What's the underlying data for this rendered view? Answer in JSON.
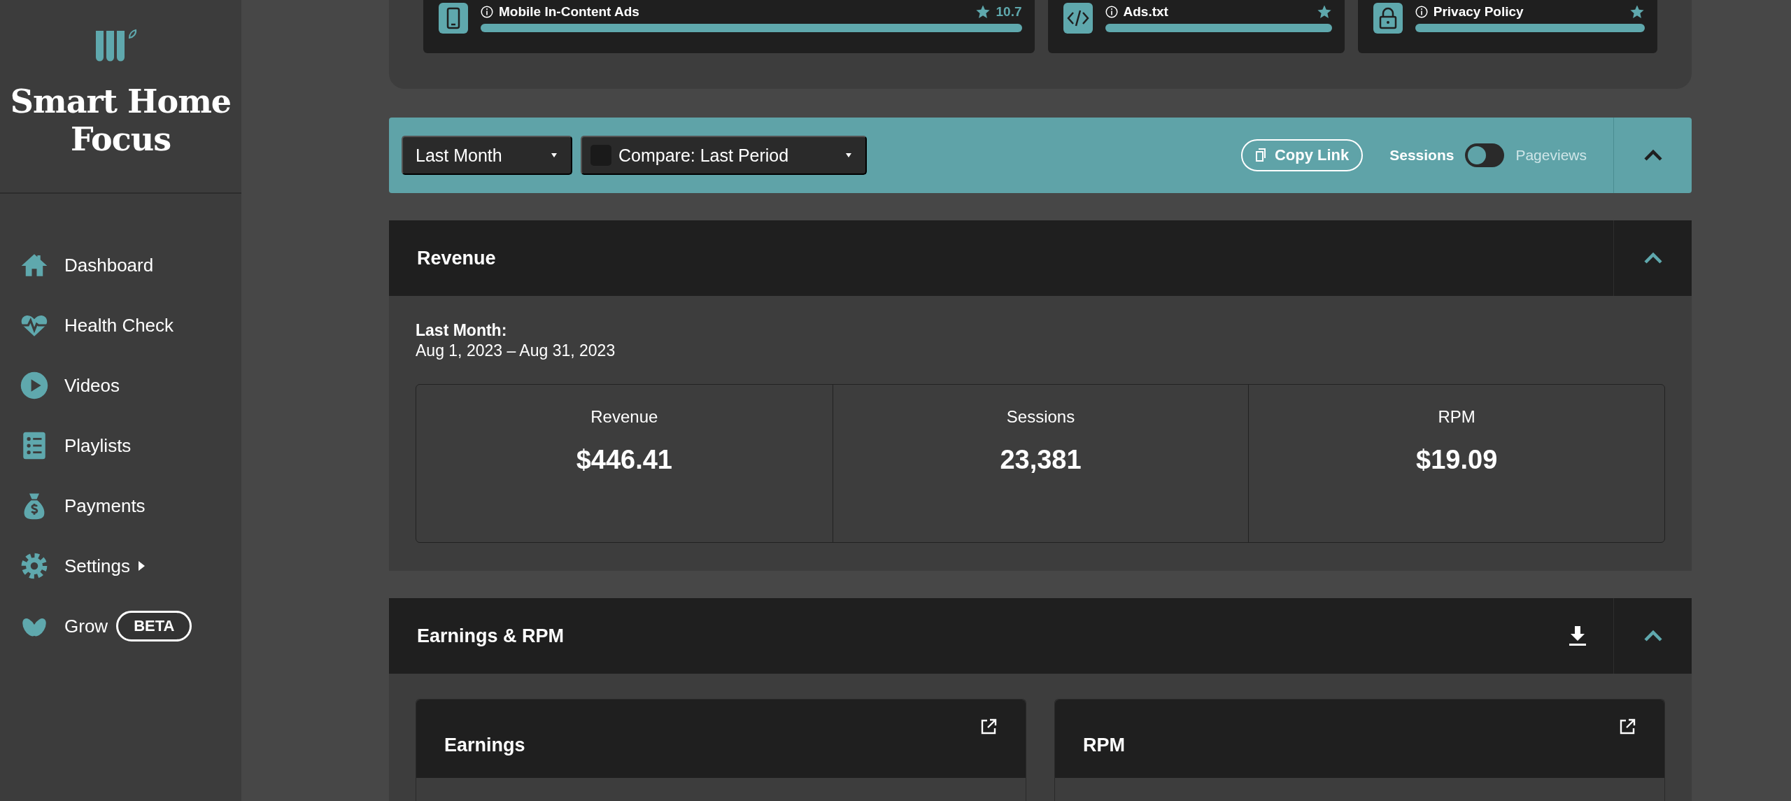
{
  "sidebar": {
    "brand": "Smart Home Focus",
    "nav": [
      {
        "label": "Dashboard",
        "has_submenu": false
      },
      {
        "label": "Health Check",
        "has_submenu": false
      },
      {
        "label": "Videos",
        "has_submenu": false
      },
      {
        "label": "Playlists",
        "has_submenu": false
      },
      {
        "label": "Payments",
        "has_submenu": false
      },
      {
        "label": "Settings",
        "has_submenu": true
      },
      {
        "label": "Grow",
        "has_submenu": false,
        "badge": "BETA"
      }
    ]
  },
  "health_items": [
    {
      "title": "Mobile In-Content Ads",
      "level": 1,
      "score": "10.7"
    },
    {
      "title": "Ads.txt",
      "level": 1
    },
    {
      "title": "Privacy Policy",
      "level": 1
    }
  ],
  "filter_bar": {
    "period": "Last Month",
    "compare": {
      "checked": false,
      "label": "Compare: Last Period"
    },
    "copy_link": "Copy Link",
    "expanded": true,
    "metric_toggle": [
      {
        "label": "Sessions",
        "selected": true
      },
      {
        "label": "Pageviews",
        "selected": false
      }
    ]
  },
  "revenue": {
    "title": "Revenue",
    "expanded": true,
    "period_label": "Last Month:",
    "date_range": "Aug 1, 2023 – Aug 31, 2023",
    "stats": [
      {
        "label": "Revenue",
        "value": "$446.41"
      },
      {
        "label": "Sessions",
        "value": "23,381"
      },
      {
        "label": "RPM",
        "value": "$19.09"
      }
    ]
  },
  "earnings": {
    "title": "Earnings & RPM",
    "expanded": true,
    "cards": [
      {
        "title": "Earnings"
      },
      {
        "title": "RPM"
      }
    ]
  }
}
